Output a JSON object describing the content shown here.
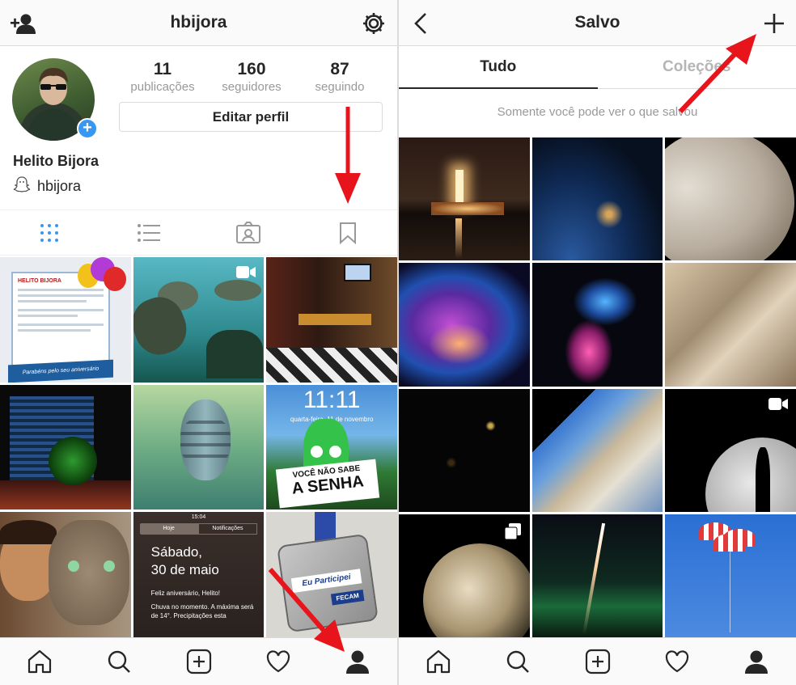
{
  "profile_screen": {
    "username": "hbijora",
    "stats": [
      {
        "number": "11",
        "label": "publicações"
      },
      {
        "number": "160",
        "label": "seguidores"
      },
      {
        "number": "87",
        "label": "seguindo"
      }
    ],
    "edit_profile_label": "Editar perfil",
    "full_name": "Helito Bijora",
    "snapchat_handle": "hbijora",
    "posts": {
      "card_title": "HELITO BIJORA",
      "card_banner": "Parabéns pelo seu aniversário",
      "lock_time": "11:11",
      "lock_date": "quarta-feira, 11 de novembro",
      "sign_line1": "VOCÊ NÃO SABE",
      "sign_line2": "A SENHA",
      "notif_tab_today": "Hoje",
      "notif_tab_notifications": "Notificações",
      "notif_status_time": "15:04",
      "notif_date_line1": "Sábado,",
      "notif_date_line2": "30 de maio",
      "notif_birthday": "Feliz aniversário, Helito!",
      "notif_weather": "Chuva no momento. A máxima será de 14°. Precipitações esta",
      "medal_text": "Eu Participei",
      "medal_brand": "FECAM"
    }
  },
  "saved_screen": {
    "title": "Salvo",
    "tabs": [
      "Tudo",
      "Coleções"
    ],
    "notice": "Somente você pode ver o que salvou"
  },
  "colors": {
    "accent_blue": "#3897f0",
    "arrow_red": "#e8141b",
    "divider": "#dbdbdb"
  }
}
